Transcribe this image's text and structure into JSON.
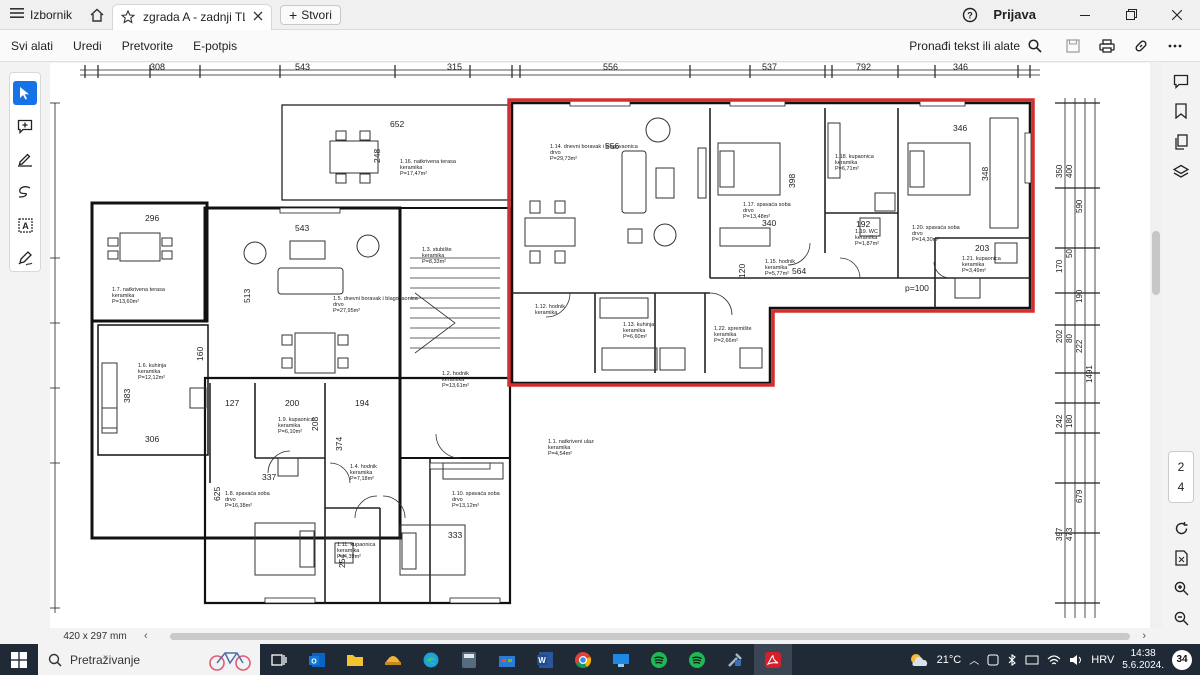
{
  "titlebar": {
    "menu_label": "Izbornik",
    "tab_title": "zgrada A - zadnji  TLO...",
    "new_tab_label": "Stvori",
    "signin_label": "Prijava"
  },
  "toolbar": {
    "menus": [
      "Svi alati",
      "Uredi",
      "Pretvorite",
      "E-potpis"
    ],
    "find_label": "Pronađi tekst ili alate"
  },
  "document": {
    "page_size": "420 x 297 mm",
    "top_dims": [
      "308",
      "543",
      "315",
      "556",
      "537",
      "792",
      "346"
    ],
    "right_dims": [
      "350",
      "400",
      "590",
      "170",
      "50",
      "190",
      "202",
      "80",
      "222",
      "1491",
      "242",
      "180",
      "679",
      "397",
      "473"
    ],
    "rooms": [
      {
        "id": "1.16",
        "label": "1.16. natkrivena terasa",
        "sub": "keramika",
        "area": "P=17,47m²"
      },
      {
        "id": "1.14",
        "label": "1.14. dnevni boravak i blagovaonica",
        "sub": "drvo",
        "area": "P=29,73m²"
      },
      {
        "id": "1.17",
        "label": "1.17. spavaća soba",
        "sub": "drvo",
        "area": "P=13,48m²"
      },
      {
        "id": "1.18",
        "label": "1.18. kupaonica",
        "sub": "keramika",
        "area": "P=6,71m²"
      },
      {
        "id": "1.20",
        "label": "1.20. spavaća soba",
        "sub": "drvo",
        "area": "P=14,30m²"
      },
      {
        "id": "1.19",
        "label": "1.19. WC",
        "sub": "keramika",
        "area": "P=1,87m²"
      },
      {
        "id": "1.21",
        "label": "1.21. kupaonica",
        "sub": "keramika",
        "area": "P=3,49m²"
      },
      {
        "id": "1.15",
        "label": "1.15. hodnik",
        "sub": "keramika",
        "area": "P=5,77m²"
      },
      {
        "id": "1.7",
        "label": "1.7. natkrivena terasa",
        "sub": "keramika",
        "area": "P=13,60m²"
      },
      {
        "id": "1.5",
        "label": "1.5. dnevni boravak i blagovaonica",
        "sub": "drvo",
        "area": "P=27,95m²"
      },
      {
        "id": "1.3",
        "label": "1.3. stubište",
        "sub": "keramika",
        "area": "P=8,33m²"
      },
      {
        "id": "1.12",
        "label": "1.12. hodnik",
        "sub": "keramika",
        "area": ""
      },
      {
        "id": "1.13k",
        "label": "1.13. kuhinja",
        "sub": "keramika",
        "area": "P=6,60m²"
      },
      {
        "id": "1.22",
        "label": "1.22. spremište",
        "sub": "keramika",
        "area": "P=2,66m²"
      },
      {
        "id": "1.6",
        "label": "1.6. kuhinja",
        "sub": "keramika",
        "area": "P=12,12m²"
      },
      {
        "id": "1.2",
        "label": "1.2. hodnik",
        "sub": "keramika",
        "area": "P=13,61m²"
      },
      {
        "id": "1.9",
        "label": "1.9. kupaonica",
        "sub": "keramika",
        "area": "P=6,10m²"
      },
      {
        "id": "1.1",
        "label": "1.1. natkriveni ulaz",
        "sub": "keramika",
        "area": "P=4,54m²"
      },
      {
        "id": "1.4",
        "label": "1.4. hodnik",
        "sub": "keramika",
        "area": "P=7,18m²"
      },
      {
        "id": "1.8",
        "label": "1.8. spavaća soba",
        "sub": "drvo",
        "area": "P=16,38m²"
      },
      {
        "id": "1.10",
        "label": "1.10. spavaća soba",
        "sub": "drvo",
        "area": "P=13,12m²"
      },
      {
        "id": "1.11",
        "label": "1.11. kupaonica",
        "sub": "keramika",
        "area": "P=4,39m²"
      }
    ],
    "inner_dims": {
      "d652": "652",
      "d248": "248",
      "d296": "296",
      "d543": "543",
      "d513": "513",
      "d556": "556",
      "d398": "398",
      "d340": "340",
      "d346": "346",
      "d348": "348",
      "d192": "192",
      "d203": "203",
      "d564": "564",
      "d120": "120",
      "d383": "383",
      "d160": "160",
      "d306": "306",
      "d127": "127",
      "d200": "200",
      "d208": "208",
      "d194": "194",
      "d374": "374",
      "d337": "337",
      "d625": "625",
      "d333": "333",
      "d254": "254",
      "dp100": "p=100"
    },
    "highlight_color": "#d32f2f"
  },
  "page_nav": {
    "current": "2",
    "total": "4"
  },
  "taskbar": {
    "search_placeholder": "Pretraživanje",
    "weather": "21°C",
    "language": "HRV",
    "time": "14:38",
    "date": "5.6.2024.",
    "notifications": "34"
  }
}
